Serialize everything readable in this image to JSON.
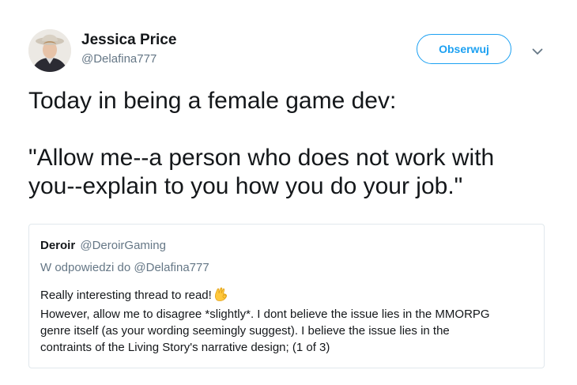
{
  "author": {
    "name": "Jessica Price",
    "handle": "@Delafina777"
  },
  "follow_button": {
    "label": "Obserwuj"
  },
  "tweet": {
    "line1": "Today in being a female game dev:",
    "line2": "\"Allow me--a person who does not work with\nyou--explain to you how you do your job.\""
  },
  "quoted_tweet": {
    "name": "Deroir",
    "handle": "@DeroirGaming",
    "reply_to": "W odpowiedzi do @Delafina777",
    "line1": "Really interesting thread to read!",
    "line2": "However, allow me to disagree *slightly*. I dont believe the issue lies in the MMORPG",
    "line3": "genre itself (as your wording seemingly suggest). I believe the issue lies in the",
    "line4": "contraints of the Living Story's narrative design; (1 of 3)"
  },
  "icons": {
    "caret": "chevron-down-icon",
    "emoji": "ok-hand-icon"
  },
  "colors": {
    "accent": "#1da1f2",
    "text": "#14171a",
    "muted": "#657786",
    "border": "#e1e8ed"
  }
}
